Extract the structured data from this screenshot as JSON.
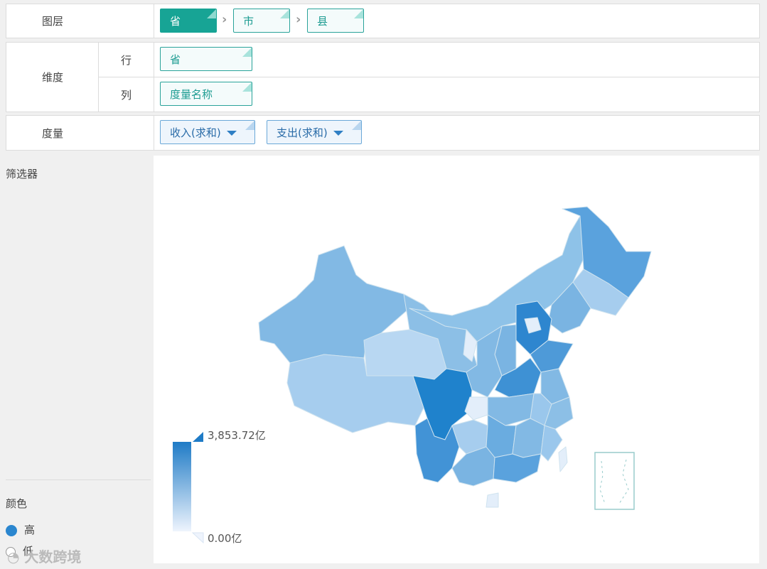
{
  "layers": {
    "label": "图层",
    "items": [
      "省",
      "市",
      "县"
    ]
  },
  "dimension": {
    "label": "维度",
    "row_label": "行",
    "row_value": "省",
    "col_label": "列",
    "col_value": "度量名称"
  },
  "measure": {
    "label": "度量",
    "items": [
      "收入(求和)",
      "支出(求和)"
    ]
  },
  "filter": {
    "label": "筛选器"
  },
  "color": {
    "label": "颜色",
    "high": "高",
    "low": "低",
    "scale_colors": [
      "#1f7bc6",
      "#eef4fd"
    ]
  },
  "legend": {
    "max": "3,853.72亿",
    "min": "0.00亿"
  },
  "watermark": "大数跨境"
}
